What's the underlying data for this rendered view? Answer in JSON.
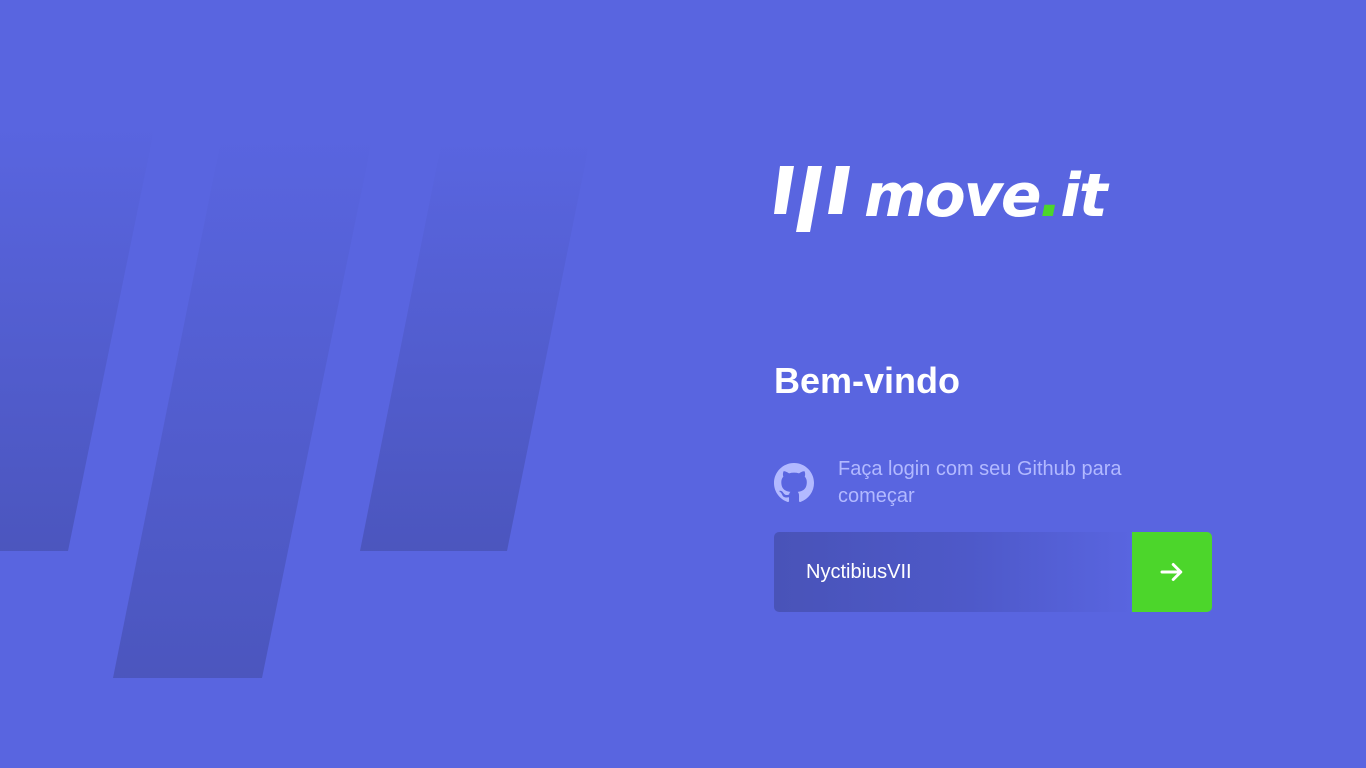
{
  "logo": {
    "name_main": "move",
    "name_dot": ".",
    "name_suffix": "it",
    "accent_color": "#4cd62b"
  },
  "login": {
    "title": "Bem-vindo",
    "github_message": "Faça login com seu Github para começar",
    "username_value": "NyctibiusVII",
    "submit_icon": "arrow-right-icon",
    "github_icon": "github-icon"
  },
  "colors": {
    "background": "#5965e0",
    "input_background": "#4953b8",
    "secondary_text": "#b2b9ff",
    "button": "#4cd62b"
  }
}
